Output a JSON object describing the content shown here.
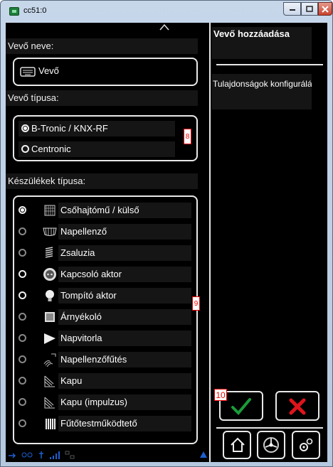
{
  "window": {
    "title": "cc51:0"
  },
  "left": {
    "receiver_name_label": "Vevő neve:",
    "receiver_name_value": "Vevő",
    "receiver_type_label": "Vevő típusa:",
    "receiver_types": [
      {
        "label": "B-Tronic / KNX-RF",
        "selected": true
      },
      {
        "label": "Centronic",
        "selected": false
      }
    ],
    "marker_8": "8",
    "device_types_label": "Készülékek típusa:",
    "marker_9": "9",
    "devices": [
      {
        "label": "Csőhajtómű / külső",
        "selected": true,
        "enabled": true,
        "icon": "tubular-motor-icon"
      },
      {
        "label": "Napellenző",
        "selected": false,
        "enabled": false,
        "icon": "awning-icon"
      },
      {
        "label": "Zsaluzia",
        "selected": false,
        "enabled": false,
        "icon": "venetian-blind-icon"
      },
      {
        "label": "Kapcsoló aktor",
        "selected": false,
        "enabled": true,
        "icon": "socket-switch-icon"
      },
      {
        "label": "Tompító aktor",
        "selected": false,
        "enabled": true,
        "icon": "bulb-icon"
      },
      {
        "label": "Árnyékoló",
        "selected": false,
        "enabled": false,
        "icon": "shade-icon"
      },
      {
        "label": "Napvitorla",
        "selected": false,
        "enabled": false,
        "icon": "sail-icon"
      },
      {
        "label": "Napellenzőfűtés",
        "selected": false,
        "enabled": false,
        "icon": "awning-heater-icon"
      },
      {
        "label": "Kapu",
        "selected": false,
        "enabled": false,
        "icon": "gate-icon"
      },
      {
        "label": "Kapu (impulzus)",
        "selected": false,
        "enabled": false,
        "icon": "gate-impulse-icon"
      },
      {
        "label": "Fűtőtestműködtető",
        "selected": false,
        "enabled": false,
        "icon": "radiator-actuator-icon"
      }
    ]
  },
  "right": {
    "title": "Vevő hozzáadása",
    "subtitle": "Tulajdonságok konfigurálása",
    "marker_10": "10",
    "ok_icon": "checkmark-icon",
    "cancel_icon": "x-icon",
    "colors": {
      "ok": "#1a9c3a",
      "cancel": "#e0141c",
      "accent": "#1d5fd0"
    }
  }
}
